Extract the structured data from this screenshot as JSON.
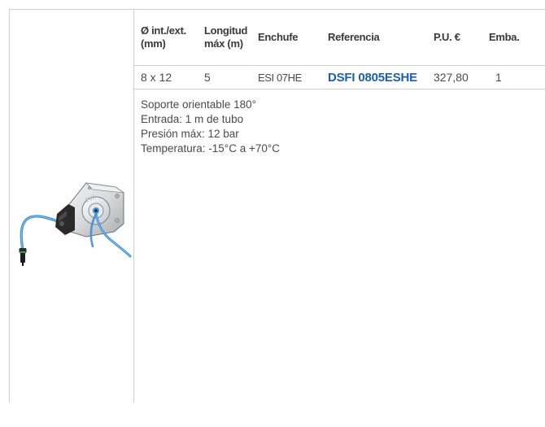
{
  "table": {
    "headers": {
      "diam": "Ø int./ext. (mm)",
      "longitud": "Longitud máx (m)",
      "enchufe": "Enchufe",
      "referencia": "Referencia",
      "pu": "P.U. €",
      "emb": "Emba."
    },
    "rows": [
      {
        "diam": "8 x 12",
        "longitud": "5",
        "enchufe": "ESI 07HE",
        "referencia": "DSFI 0805ESHE",
        "pu": "327,80",
        "emb": "1"
      }
    ]
  },
  "features": [
    "Soporte orientable 180°",
    "Entrada: 1 m de tubo",
    "Presión máx: 12 bar",
    "Temperatura: -15°C a +70°C"
  ],
  "colors": {
    "reference_blue": "#1d5fab",
    "hose_blue": "#3f8fd6",
    "border_gray": "#cfcfcf"
  },
  "image": {
    "icon": "hose-reel-product-photo"
  }
}
